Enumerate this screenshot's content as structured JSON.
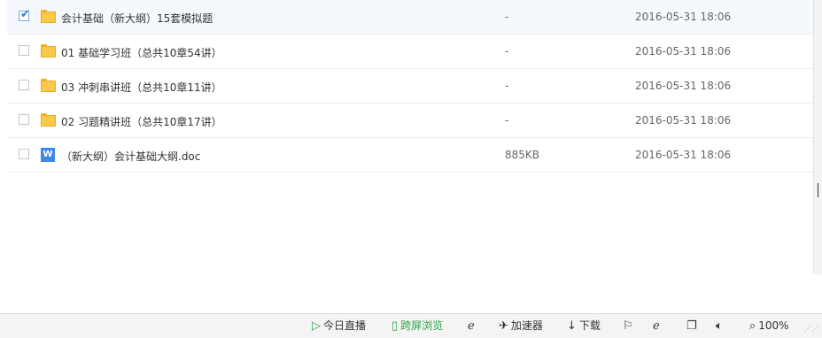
{
  "files": [
    {
      "name": "会计基础（新大纲）15套模拟题",
      "size": "-",
      "date": "2016-05-31 18:06",
      "type": "folder",
      "checked": true
    },
    {
      "name": "01 基础学习班（总共10章54讲）",
      "size": "-",
      "date": "2016-05-31 18:06",
      "type": "folder",
      "checked": false
    },
    {
      "name": "03 冲刺串讲班（总共10章11讲）",
      "size": "-",
      "date": "2016-05-31 18:06",
      "type": "folder",
      "checked": false
    },
    {
      "name": "02 习题精讲班（总共10章17讲）",
      "size": "-",
      "date": "2016-05-31 18:06",
      "type": "folder",
      "checked": false
    },
    {
      "name": "（新大纲）会计基础大纲.doc",
      "size": "885KB",
      "date": "2016-05-31 18:06",
      "type": "word-doc",
      "checked": false
    }
  ],
  "status_bar": {
    "live_label": "今日直播",
    "cross_screen_label": "跨屏浏览",
    "accelerator_label": "加速器",
    "download_label": "下载",
    "zoom_label": "100%"
  },
  "icons": {
    "folder": "folder-icon",
    "word": "word-doc-icon",
    "check": "checkmark-icon"
  },
  "colors": {
    "accent_blue": "#2f78db",
    "green": "#2ba245",
    "folder": "#fbc94a"
  }
}
